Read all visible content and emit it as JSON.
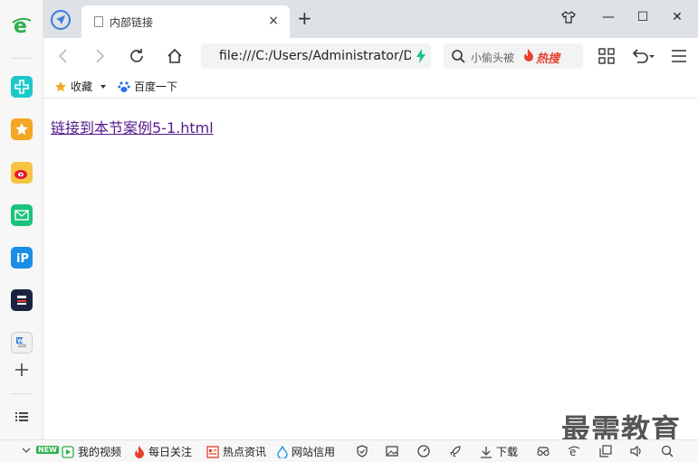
{
  "tab": {
    "title": "内部链接",
    "close_glyph": "×",
    "new_tab_glyph": "+"
  },
  "window": {
    "minimize_glyph": "—",
    "maximize_glyph": "☐",
    "close_glyph": "✕"
  },
  "address_bar": {
    "url": "file:///C:/Users/Administrator/De"
  },
  "search_box": {
    "placeholder": "小偷头被",
    "hot_label": "热搜"
  },
  "bookmarks": {
    "items": [
      {
        "label": "收藏"
      },
      {
        "label": "百度一下"
      }
    ]
  },
  "content": {
    "link_text": "链接到本节案例5-1.html"
  },
  "watermark": {
    "text": "最需教育"
  },
  "statusbar": {
    "new_badge": "NEW",
    "items": [
      {
        "label": "我的视频"
      },
      {
        "label": "每日关注"
      },
      {
        "label": "热点资讯"
      },
      {
        "label": "网站信用"
      },
      {
        "label": "下载"
      }
    ]
  },
  "colors": {
    "accent": "#3b7be0",
    "link_visited": "#551a8b",
    "tabbar_bg": "#dee1e6",
    "hot": "#e8412c",
    "bolt": "#19c37d"
  }
}
